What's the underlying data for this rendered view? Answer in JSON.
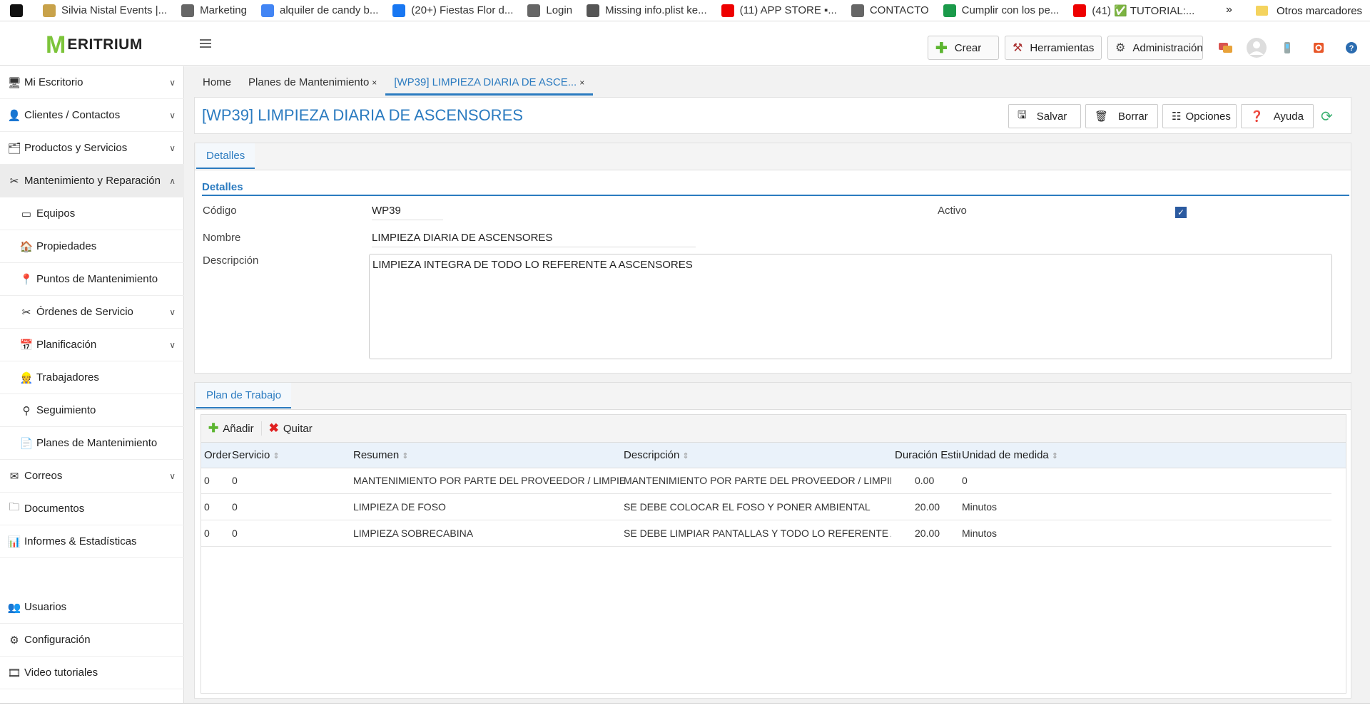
{
  "bookmarks": [
    {
      "label": "",
      "icon": "as-icon",
      "color": "#111"
    },
    {
      "label": "Silvia Nistal Events |...",
      "icon": "sn-icon",
      "color": "#c8a24a"
    },
    {
      "label": "Marketing",
      "icon": "globe-icon",
      "color": "#666"
    },
    {
      "label": "alquiler de candy b...",
      "icon": "google-icon",
      "color": "#4285f4"
    },
    {
      "label": "(20+) Fiestas Flor d...",
      "icon": "facebook-icon",
      "color": "#1877f2"
    },
    {
      "label": "Login",
      "icon": "globe-icon",
      "color": "#666"
    },
    {
      "label": "Missing info.plist ke...",
      "icon": "apple-icon",
      "color": "#555"
    },
    {
      "label": "(11) APP STORE ▪...",
      "icon": "youtube-icon",
      "color": "#e00"
    },
    {
      "label": "CONTACTO",
      "icon": "globe-icon",
      "color": "#666"
    },
    {
      "label": "Cumplir con los pe...",
      "icon": "s-icon",
      "color": "#1a9a4a"
    },
    {
      "label": "(41) ✅ TUTORIAL:...",
      "icon": "youtube-icon",
      "color": "#e00"
    }
  ],
  "bookmarks_more": "»",
  "bookmarks_other": "Otros marcadores",
  "brand": {
    "m": "M",
    "name": "ERITRIUM"
  },
  "top_buttons": {
    "create": "Crear",
    "tools": "Herramientas",
    "admin": "Administración"
  },
  "sidebar": [
    {
      "label": "Mi Escritorio",
      "icon": "desk-icon",
      "chevron": "∨"
    },
    {
      "label": "Clientes / Contactos",
      "icon": "contacts-icon",
      "chevron": "∨"
    },
    {
      "label": "Productos y Servicios",
      "icon": "products-icon",
      "chevron": "∨"
    },
    {
      "label": "Mantenimiento y Reparación",
      "icon": "tools-icon",
      "chevron": "∧"
    },
    {
      "label": "Equipos",
      "icon": "monitor-icon",
      "chevron": ""
    },
    {
      "label": "Propiedades",
      "icon": "property-icon",
      "chevron": ""
    },
    {
      "label": "Puntos de Mantenimiento",
      "icon": "map-pin-icon",
      "chevron": ""
    },
    {
      "label": "Órdenes de Servicio",
      "icon": "wrench-icon",
      "chevron": "∨"
    },
    {
      "label": "Planificación",
      "icon": "calendar-icon",
      "chevron": "∨"
    },
    {
      "label": "Trabajadores",
      "icon": "worker-icon",
      "chevron": ""
    },
    {
      "label": "Seguimiento",
      "icon": "tracking-icon",
      "chevron": ""
    },
    {
      "label": "Planes de Mantenimiento",
      "icon": "document-icon",
      "chevron": ""
    },
    {
      "label": "Correos",
      "icon": "mail-icon",
      "chevron": "∨"
    },
    {
      "label": "Documentos",
      "icon": "folder-icon",
      "chevron": ""
    },
    {
      "label": "Informes & Estadísticas",
      "icon": "chart-icon",
      "chevron": ""
    },
    {
      "label": "Usuarios",
      "icon": "users-icon",
      "chevron": ""
    },
    {
      "label": "Configuración",
      "icon": "gear-icon",
      "chevron": ""
    },
    {
      "label": "Video tutoriales",
      "icon": "video-icon",
      "chevron": ""
    }
  ],
  "tabs": [
    {
      "label": "Home",
      "close": ""
    },
    {
      "label": "Planes de Mantenimiento",
      "close": "×"
    },
    {
      "label": "[WP39] LIMPIEZA DIARIA DE ASCE...",
      "close": "×"
    }
  ],
  "page_title": "[WP39] LIMPIEZA DIARIA DE ASCENSORES",
  "actions": {
    "save": "Salvar",
    "delete": "Borrar",
    "options": "Opciones",
    "help": "Ayuda"
  },
  "details": {
    "tab": "Detalles",
    "section": "Detalles",
    "code_label": "Código",
    "code": "WP39",
    "active_label": "Activo",
    "active_checked": true,
    "name_label": "Nombre",
    "name": "LIMPIEZA DIARIA DE ASCENSORES",
    "desc_label": "Descripción",
    "description": "LIMPIEZA INTEGRA DE TODO LO REFERENTE A ASCENSORES"
  },
  "plan": {
    "tab": "Plan de Trabajo",
    "add": "Añadir",
    "remove": "Quitar",
    "columns": [
      "Orden",
      "Servicio",
      "Resumen",
      "Descripción",
      "Duración Estimac",
      "Unidad de medida"
    ],
    "rows": [
      [
        "0",
        "0",
        "MANTENIMIENTO POR PARTE DEL PROVEEDOR / LIMPIEZA DIARIA",
        "MANTENIMIENTO POR PARTE DEL PROVEEDOR / LIMPIEZA DIARIA",
        "0.00",
        "0"
      ],
      [
        "0",
        "0",
        "LIMPIEZA DE FOSO",
        "SE DEBE COLOCAR EL FOSO Y PONER AMBIENTAL",
        "20.00",
        "Minutos"
      ],
      [
        "0",
        "0",
        "LIMPIEZA SOBRECABINA",
        "SE DEBE LIMPIAR PANTALLAS Y TODO LO REFERENTE A LA PARTE SUPE",
        "20.00",
        "Minutos"
      ]
    ]
  },
  "colors": {
    "accent": "#2b7bc0",
    "brand": "#7cc43a"
  }
}
